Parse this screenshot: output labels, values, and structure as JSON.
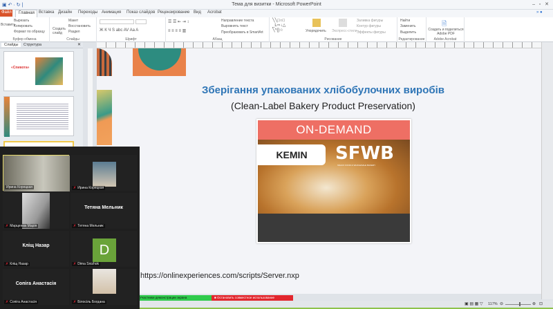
{
  "window": {
    "title": "Тема для визитки - Microsoft PowerPoint"
  },
  "tabs": [
    "Главная",
    "Вставка",
    "Дизайн",
    "Переходы",
    "Анимация",
    "Показ слайдов",
    "Рецензирование",
    "Вид",
    "Acrobat"
  ],
  "file_tab": "Файл",
  "ribbon": {
    "clipboard": {
      "label": "Буфер обмена",
      "paste": "Вставить",
      "cut": "Вырезать",
      "copy": "Копировать",
      "format": "Формат по образцу"
    },
    "slides": {
      "label": "Слайды",
      "new": "Создать слайд",
      "layout": "Макет",
      "reset": "Восстановить",
      "section": "Раздел"
    },
    "font": {
      "label": "Шрифт"
    },
    "paragraph": {
      "label": "Абзац",
      "direction": "Направление текста",
      "align": "Выровнять текст",
      "smartart": "Преобразовать в SmartArt"
    },
    "drawing": {
      "label": "Рисование",
      "arrange": "Упорядочить",
      "styles": "Экспресс-стили",
      "fill": "Заливка фигуры",
      "outline": "Контур фигуры",
      "effects": "Эффекты фигуры"
    },
    "editing": {
      "label": "Редактирование",
      "find": "Найти",
      "replace": "Заменить",
      "select": "Выделить"
    },
    "acrobat": {
      "label": "Adobe Acrobat",
      "create": "Создать и поделиться Adobe PDF"
    }
  },
  "panel": {
    "tab_slides": "Слайды",
    "tab_outline": "Структура",
    "thumb1_title": "«Спивота»"
  },
  "slide": {
    "title": "Зберігання упакованих хлібобулочних виробів",
    "subtitle": "(Clean-Label Bakery Product Preservation)",
    "image_band": "ON-DEMAND",
    "logo1": "KEMIN",
    "logo2": "SFWB",
    "logo2_sub": "SNACK FOOD & WHOLESALE BAKERY",
    "url": "https://onlinexperiences.com/scripts/Server.nxp"
  },
  "zoom": {
    "participants": [
      {
        "name": "Ирина Корецкая",
        "video": true
      },
      {
        "name": "Ирина Корецкая",
        "video": true
      },
      {
        "name": "Марценюк Марія",
        "video": true
      },
      {
        "name": "Тетяна Мельник",
        "video": false,
        "display": "Тетяна Мельник"
      },
      {
        "name": "Кліщ Назар",
        "video": false,
        "display": "Кліщ Назар"
      },
      {
        "name": "Dima Snizhok",
        "video": false,
        "avatar": "D"
      },
      {
        "name": "Сопіга Анастасія",
        "video": false,
        "display": "Сопіга Анастасія"
      },
      {
        "name": "Білосіль Богдана",
        "video": true
      }
    ]
  },
  "sharebar": {
    "status": "Участники демонстрации экрана",
    "stop": "Остановить совместное использование"
  },
  "statusbar": {
    "zoom": "117%"
  },
  "colors": {
    "accent": "#2e75b6",
    "file_tab": "#d9542b",
    "share_green": "#2fcb4c",
    "share_red": "#e2262d",
    "avatar": "#6aa33a"
  }
}
